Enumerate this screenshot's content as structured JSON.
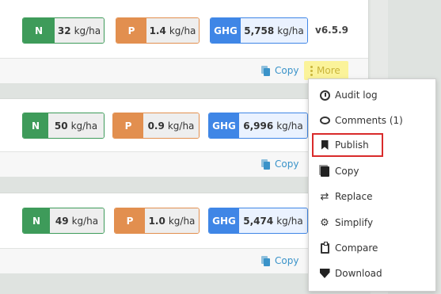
{
  "cards": [
    {
      "n": {
        "key": "N",
        "value": "32",
        "unit": "kg/ha"
      },
      "p": {
        "key": "P",
        "value": "1.4",
        "unit": "kg/ha"
      },
      "ghg": {
        "key": "GHG",
        "value": "5,758",
        "unit": "kg/ha"
      },
      "version": "v6.5.9",
      "copy_label": "Copy",
      "more_label": "More"
    },
    {
      "n": {
        "key": "N",
        "value": "50",
        "unit": "kg/ha"
      },
      "p": {
        "key": "P",
        "value": "0.9",
        "unit": "kg/ha"
      },
      "ghg": {
        "key": "GHG",
        "value": "6,996",
        "unit": "kg/ha"
      },
      "copy_label": "Copy"
    },
    {
      "n": {
        "key": "N",
        "value": "49",
        "unit": "kg/ha"
      },
      "p": {
        "key": "P",
        "value": "1.0",
        "unit": "kg/ha"
      },
      "ghg": {
        "key": "GHG",
        "value": "5,474",
        "unit": "kg/ha"
      },
      "copy_label": "Copy"
    }
  ],
  "menu": {
    "items": [
      {
        "label": "Audit log",
        "icon": "clock-icon"
      },
      {
        "label": "Comments (1)",
        "icon": "comment-icon"
      },
      {
        "label": "Publish",
        "icon": "bookmark-icon"
      },
      {
        "label": "Copy",
        "icon": "copy-icon"
      },
      {
        "label": "Replace",
        "icon": "swap-icon"
      },
      {
        "label": "Simplify",
        "icon": "simplify-icon"
      },
      {
        "label": "Compare",
        "icon": "clipboard-check-icon"
      },
      {
        "label": "Download",
        "icon": "download-shield-icon"
      }
    ]
  },
  "colors": {
    "n": "#3e9b5a",
    "p": "#e28f4f",
    "ghg": "#3f86e6",
    "link": "#3a93c9",
    "more_bg": "#fbf39a",
    "highlight_outline": "#d92b2b"
  }
}
